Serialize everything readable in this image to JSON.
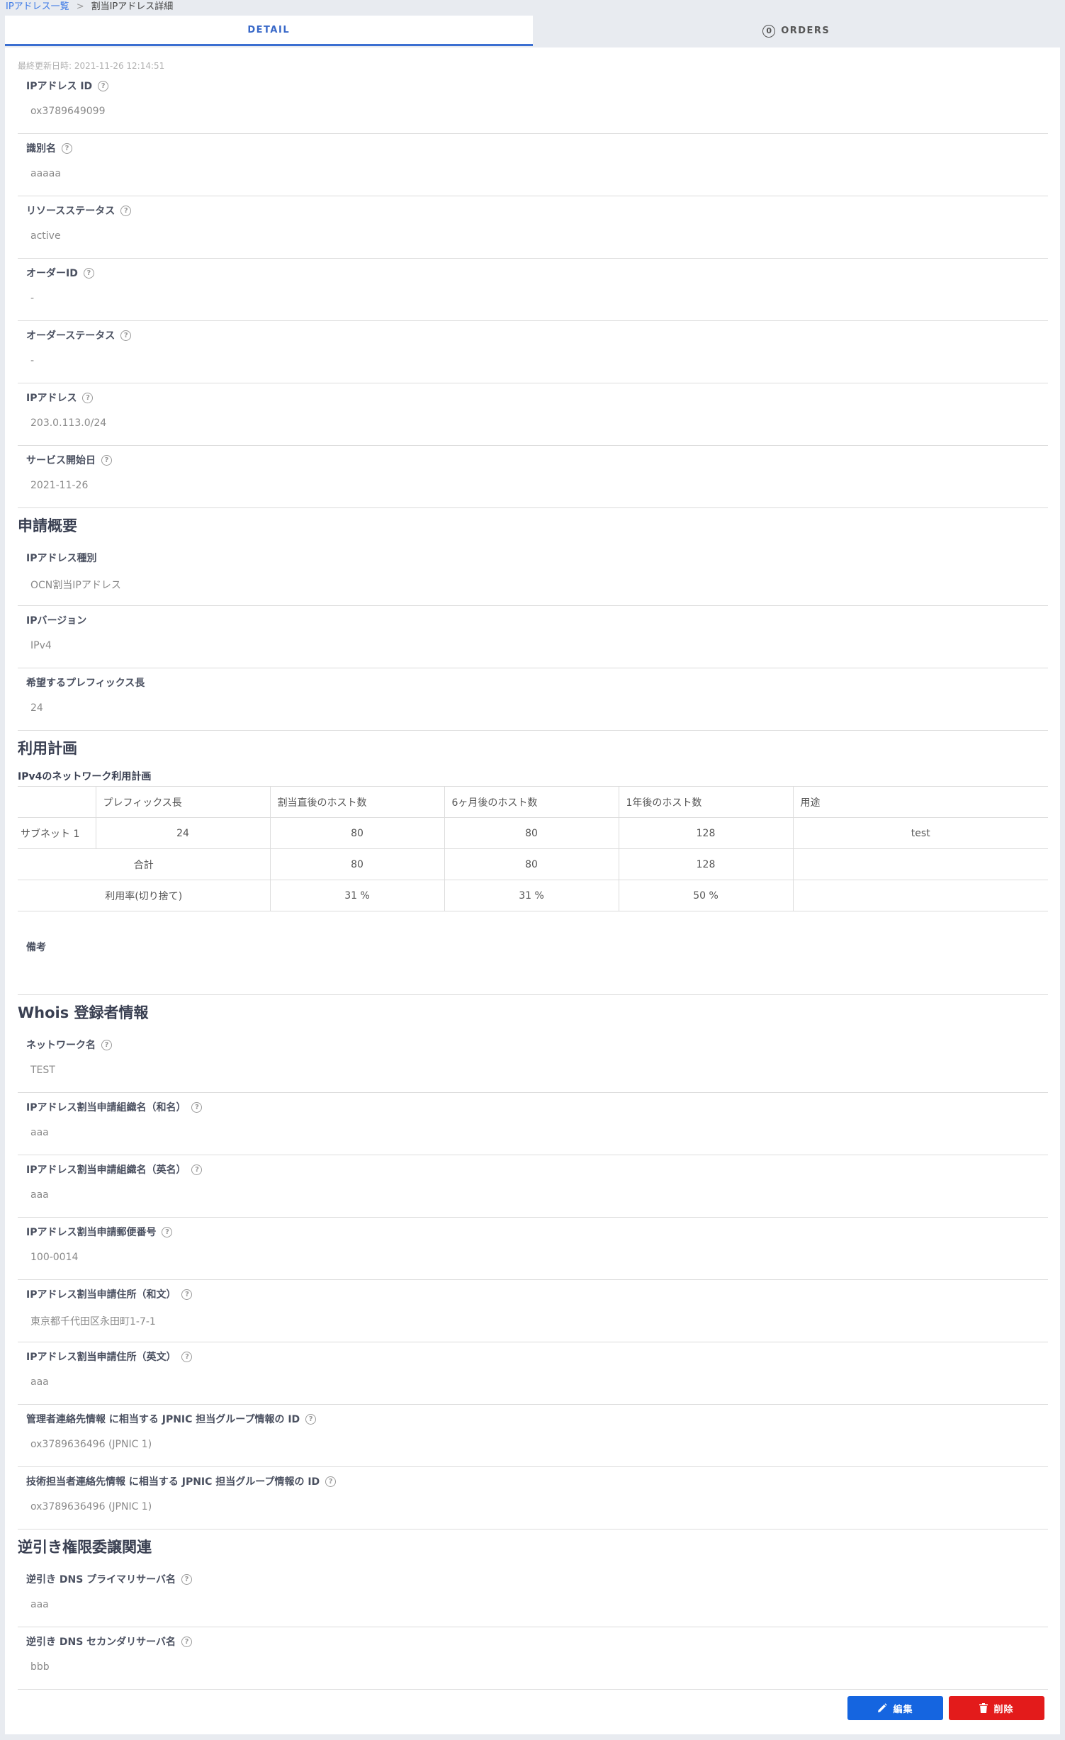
{
  "breadcrumb": {
    "parent": "IPアドレス一覧",
    "separator": ">",
    "current": "割当IPアドレス詳細"
  },
  "tabs": {
    "detail": "DETAIL",
    "orders": "ORDERS",
    "orders_count": "0"
  },
  "last_updated": "最終更新日時: 2021-11-26 12:14:51",
  "basic_fields": [
    {
      "label": "IPアドレス ID",
      "value": "ox3789649099"
    },
    {
      "label": "識別名",
      "value": "aaaaa"
    },
    {
      "label": "リソースステータス",
      "value": "active"
    },
    {
      "label": "オーダーID",
      "value": "-"
    },
    {
      "label": "オーダーステータス",
      "value": "-"
    },
    {
      "label": "IPアドレス",
      "value": "203.0.113.0/24"
    },
    {
      "label": "サービス開始日",
      "value": "2021-11-26"
    }
  ],
  "application": {
    "title": "申請概要",
    "fields": [
      {
        "label": "IPアドレス種別",
        "value": "OCN割当IPアドレス"
      },
      {
        "label": "IPバージョン",
        "value": "IPv4"
      },
      {
        "label": "希望するプレフィックス長",
        "value": "24"
      }
    ]
  },
  "plan": {
    "title": "利用計画",
    "subtitle": "IPv4のネットワーク利用計画",
    "headers": [
      "プレフィックス長",
      "割当直後のホスト数",
      "6ヶ月後のホスト数",
      "1年後のホスト数",
      "用途"
    ],
    "subnet": {
      "name": "サブネット 1",
      "prefix": "24",
      "initial": "80",
      "six_months": "80",
      "one_year": "128",
      "purpose": "test"
    },
    "total": {
      "label": "合計",
      "initial": "80",
      "six_months": "80",
      "one_year": "128"
    },
    "utilization": {
      "label": "利用率(切り捨て)",
      "initial": "31 %",
      "six_months": "31 %",
      "one_year": "50 %"
    },
    "remarks_label": "備考"
  },
  "whois": {
    "title": "Whois 登録者情報",
    "fields": [
      {
        "label": "ネットワーク名",
        "value": "TEST"
      },
      {
        "label": "IPアドレス割当申請組織名（和名）",
        "value": "aaa"
      },
      {
        "label": "IPアドレス割当申請組織名（英名）",
        "value": "aaa"
      },
      {
        "label": "IPアドレス割当申請郵便番号",
        "value": "100-0014"
      },
      {
        "label": "IPアドレス割当申請住所（和文）",
        "value": "東京都千代田区永田町1-7-1"
      },
      {
        "label": "IPアドレス割当申請住所（英文）",
        "value": "aaa"
      },
      {
        "label": "管理者連絡先情報 に相当する JPNIC 担当グループ情報の ID",
        "value": "ox3789636496 (JPNIC 1)"
      },
      {
        "label": "技術担当者連絡先情報 に相当する JPNIC 担当グループ情報の ID",
        "value": "ox3789636496 (JPNIC 1)"
      }
    ]
  },
  "delegation": {
    "title": "逆引き権限委譲関連",
    "fields": [
      {
        "label": "逆引き DNS プライマリサーバ名",
        "value": "aaa"
      },
      {
        "label": "逆引き DNS セカンダリサーバ名",
        "value": "bbb"
      }
    ]
  },
  "actions": {
    "edit": "編集",
    "delete": "削除"
  },
  "help_glyph": "?"
}
